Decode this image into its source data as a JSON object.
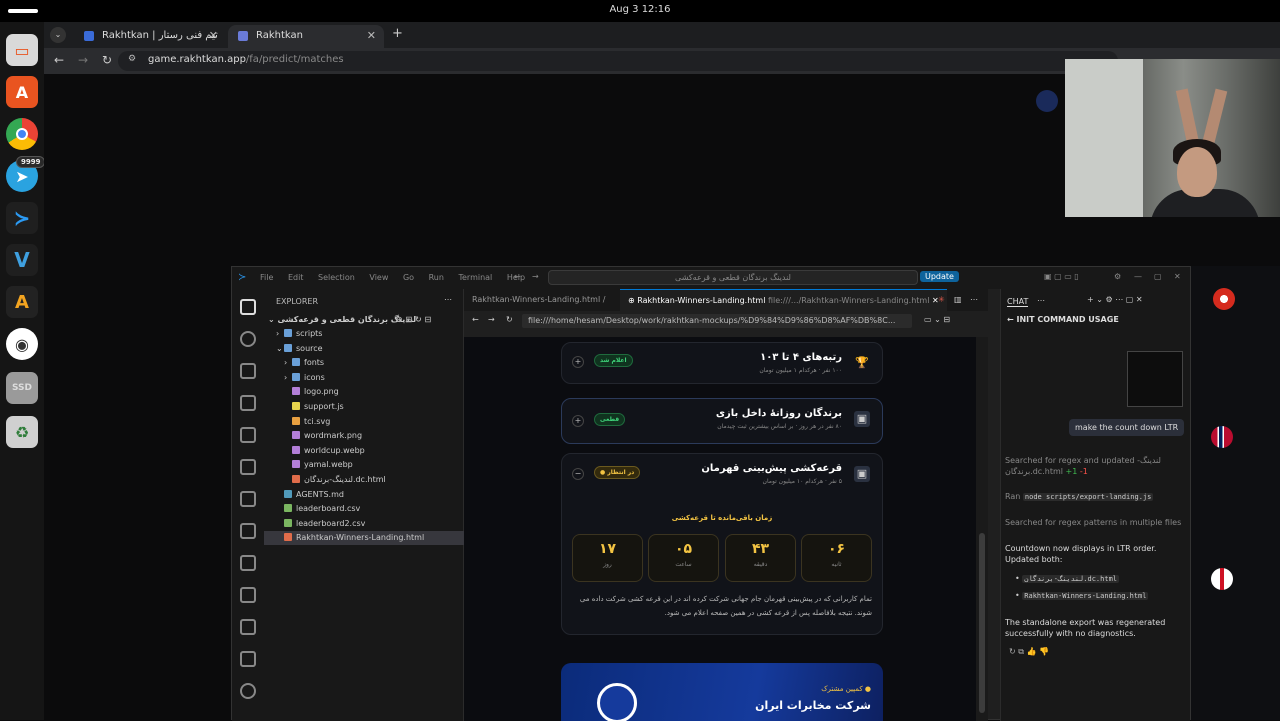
{
  "system": {
    "clock": "Aug 3  12:16",
    "telegram_badge": "9999",
    "ssd_label": "SSD"
  },
  "browser": {
    "tabs": [
      {
        "label": "Rakhtkan | تیم فنی رستار"
      },
      {
        "label": "Rakhtkan"
      }
    ],
    "new_tab": "+",
    "url_host": "game.rakhtkan.app",
    "url_path": "/fa/predict/matches"
  },
  "vscode": {
    "menu": [
      "File",
      "Edit",
      "Selection",
      "View",
      "Go",
      "Run",
      "Terminal",
      "Help"
    ],
    "command_center": "لندینگ برندگان قطعی و قرعه‌کشی",
    "update_label": "Update",
    "explorer": {
      "title": "EXPLORER",
      "root": "لندینگ برندگان قطعی و قرعه‌کشی",
      "items": [
        {
          "name": "scripts",
          "type": "folder",
          "depth": 1,
          "open": false
        },
        {
          "name": "source",
          "type": "folder",
          "depth": 1,
          "open": true
        },
        {
          "name": "fonts",
          "type": "folder",
          "depth": 2,
          "open": false
        },
        {
          "name": "icons",
          "type": "folder",
          "depth": 2,
          "open": false
        },
        {
          "name": "logo.png",
          "type": "png",
          "depth": 2
        },
        {
          "name": "support.js",
          "type": "js",
          "depth": 2
        },
        {
          "name": "tci.svg",
          "type": "svg",
          "depth": 2
        },
        {
          "name": "wordmark.png",
          "type": "png",
          "depth": 2
        },
        {
          "name": "worldcup.webp",
          "type": "img",
          "depth": 2
        },
        {
          "name": "yamal.webp",
          "type": "img",
          "depth": 2
        },
        {
          "name": "لندینگ-برندگان.dc.html",
          "type": "html",
          "depth": 2
        },
        {
          "name": "AGENTS.md",
          "type": "md",
          "depth": 1
        },
        {
          "name": "leaderboard.csv",
          "type": "csv",
          "depth": 1
        },
        {
          "name": "leaderboard2.csv",
          "type": "csv",
          "depth": 1
        },
        {
          "name": "Rakhtkan-Winners-Landing.html",
          "type": "html",
          "depth": 1,
          "selected": true
        }
      ]
    },
    "editor_tabs": [
      {
        "label": "Rakhtkan-Winners-Landing.html  /"
      },
      {
        "label": "Rakhtkan-Winners-Landing.html"
      },
      {
        "label": "file:///.../Rakhtkan-Winners-Landing.html"
      }
    ],
    "preview_url": "file:///home/hesam/Desktop/work/rakhtkan-mockups/%D9%84%D9%86%D8%AF%DB%8C...",
    "preview": {
      "cards": [
        {
          "title": "رتبه‌های ۴ تا ۱۰۳",
          "sub": "۱۰۰ نفر · هرکدام ۱ میلیون تومان",
          "pill": "اعلام شد",
          "icon": "🏆"
        },
        {
          "title": "برندگان روزانهٔ داخل بازی",
          "sub": "۸۰ نفر در هر روز · بر اساس بیشترین ثبت چیدمان",
          "pill": "قطعی",
          "icon": "▣"
        },
        {
          "title": "قرعه‌کشی پیش‌بینی قهرمان",
          "sub": "۵ نفر · هرکدام ۱۰ میلیون تومان",
          "pill": "● در انتظار",
          "icon": "▣"
        }
      ],
      "countdown_label": "زمان باقی‌مانده تا قرعه‌کشی",
      "countdown": [
        {
          "num": "۱۷",
          "label": "روز"
        },
        {
          "num": "۰۵",
          "label": "ساعت"
        },
        {
          "num": "۴۳",
          "label": "دقیقه"
        },
        {
          "num": "۰۶",
          "label": "ثانیه"
        }
      ],
      "desc": "تمام کاربرانی که در پیش‌بینی قهرمان جام جهانی شرکت کرده اند در این قرعه کشی شرکت داده می شوند. نتیجه بلافاصله پس از قرعه کشی در همین صفحه اعلام می شود.",
      "sponsor_tag": "● کمپین مشترک",
      "sponsor_name": "شرکت مخابرات ایران"
    },
    "chat": {
      "tab": "CHAT",
      "heading": "INIT COMMAND USAGE",
      "user_msg": "make the count down LTR",
      "searched1_a": "Searched",
      "searched1_b": "for regex and updated",
      "searched1_file": "لندینگ-برندگان.dc.html",
      "diff_plus": "+1",
      "diff_minus": "-1",
      "ran_a": "Ran",
      "ran_cmd": "node scripts/export-landing.js",
      "searched2_a": "Searched",
      "searched2_b": "for regex patterns in multiple files",
      "result1": "Countdown now displays in LTR order. Updated both:",
      "file1": "لندینگ-برندگان.dc.html",
      "file2": "Rakhtkan-Winners-Landing.html",
      "result2": "The standalone export was regenerated successfully with no diagnostics."
    }
  }
}
